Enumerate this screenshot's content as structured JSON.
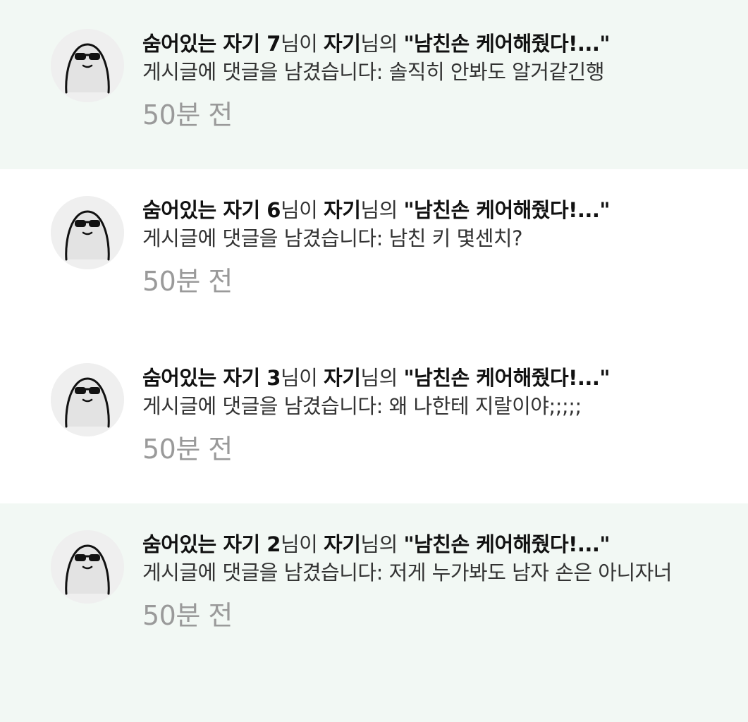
{
  "notifications": [
    {
      "read": false,
      "author": "숨어있는 자기 7",
      "mid_text": "님이 ",
      "post_owner": "자기",
      "owner_suffix": "님의 ",
      "post_title": "\"남친손 케어해줬다!...\"",
      "body_prefix": "게시글에 댓글을 남겼습니다: ",
      "comment": "솔직히 안봐도 알거같긴행",
      "time": "50분 전",
      "avatar_icon": "penguin-sunglasses-avatar-icon"
    },
    {
      "read": true,
      "author": "숨어있는 자기 6",
      "mid_text": "님이 ",
      "post_owner": "자기",
      "owner_suffix": "님의 ",
      "post_title": "\"남친손 케어해줬다!...\"",
      "body_prefix": "게시글에 댓글을 남겼습니다: ",
      "comment": "남친 키 몇센치?",
      "time": "50분 전",
      "avatar_icon": "penguin-sunglasses-avatar-icon"
    },
    {
      "read": true,
      "author": "숨어있는 자기 3",
      "mid_text": "님이 ",
      "post_owner": "자기",
      "owner_suffix": "님의 ",
      "post_title": "\"남친손 케어해줬다!...\"",
      "body_prefix": "게시글에 댓글을 남겼습니다: ",
      "comment": "왜 나한테 지랄이야;;;;;",
      "time": "50분 전",
      "avatar_icon": "penguin-sunglasses-avatar-icon"
    },
    {
      "read": false,
      "author": "숨어있는 자기 2",
      "mid_text": "님이 ",
      "post_owner": "자기",
      "owner_suffix": "님의 ",
      "post_title": "\"남친손 케어해줬다!...\"",
      "body_prefix": "게시글에 댓글을 남겼습니다: ",
      "comment": "저게 누가봐도 남자 손은 아니자너",
      "time": "50분 전",
      "avatar_icon": "penguin-sunglasses-avatar-icon"
    }
  ],
  "colors": {
    "unread_bg": "#f2f8f4",
    "read_bg": "#ffffff",
    "time_text": "#9a9a9a"
  }
}
